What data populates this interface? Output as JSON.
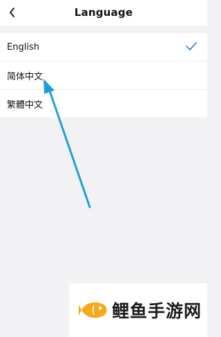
{
  "header": {
    "title": "Language",
    "back_icon": "chevron-left-icon"
  },
  "languages": [
    {
      "label": "English",
      "selected": true
    },
    {
      "label": "简体中文",
      "selected": false
    },
    {
      "label": "繁體中文",
      "selected": false
    }
  ],
  "selected_icon": "check-icon",
  "annotation": {
    "type": "arrow",
    "color": "#1e9fd6",
    "points_to": "简体中文"
  },
  "watermark": {
    "text": "鲤鱼手游网",
    "logo_color": "#f7a81b"
  },
  "colors": {
    "accent": "#3f86d3",
    "background": "#f2f2f4"
  }
}
